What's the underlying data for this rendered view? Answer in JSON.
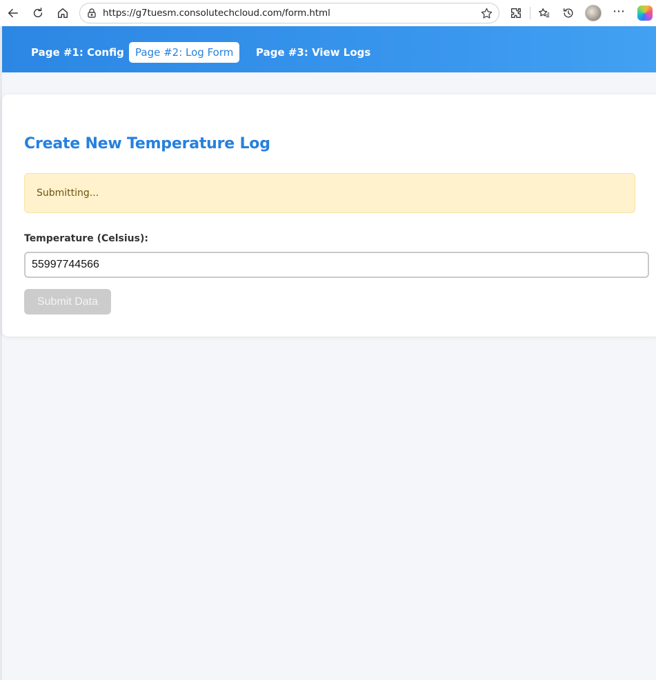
{
  "browser": {
    "url": "https://g7tuesm.consolutechcloud.com/form.html"
  },
  "nav": {
    "tabs": [
      {
        "label": "Page #1: Config",
        "active": false
      },
      {
        "label": "Page #2: Log Form",
        "active": true
      },
      {
        "label": "Page #3: View Logs",
        "active": false
      }
    ]
  },
  "form": {
    "title": "Create New Temperature Log",
    "status_message": "Submitting...",
    "temperature_label": "Temperature (Celsius):",
    "temperature_value": "55997744566",
    "submit_label": "Submit Data",
    "submit_disabled": true
  },
  "colors": {
    "accent": "#2680de",
    "nav_gradient_start": "#2b87e3",
    "nav_gradient_end": "#42a1f2",
    "alert_bg": "#fff2cc",
    "alert_text": "#6b5410",
    "button_disabled": "#cccccc",
    "page_bg": "#f4f6f9"
  },
  "icons": {
    "back": "back-arrow-icon",
    "refresh": "refresh-icon",
    "home": "home-icon",
    "lock": "lock-icon",
    "favorite": "star-icon",
    "extensions": "extensions-icon",
    "favorites": "favorites-icon",
    "history": "history-icon",
    "more": "more-icon",
    "copilot": "copilot-icon"
  }
}
